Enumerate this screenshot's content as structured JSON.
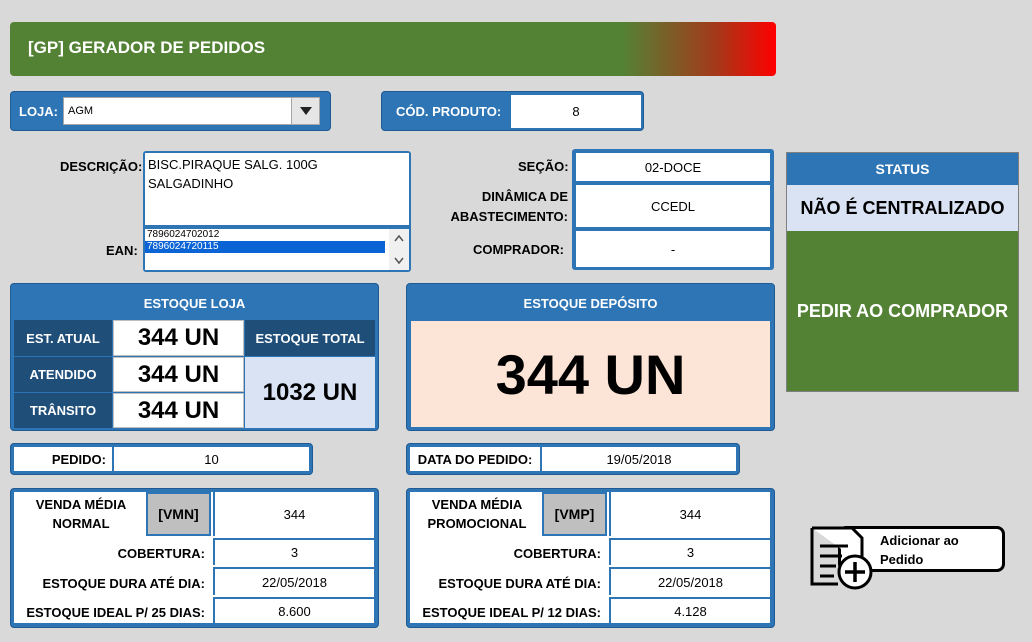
{
  "header": {
    "title": "[GP] GERADOR DE PEDIDOS"
  },
  "loja": {
    "label": "LOJA:",
    "value": "AGM"
  },
  "produto": {
    "label": "CÓD. PRODUTO:",
    "value": "8"
  },
  "descricao": {
    "label": "DESCRIÇÃO:",
    "line1": "BISC.PIRAQUE SALG. 100G",
    "line2": "SALGADINHO"
  },
  "ean": {
    "label": "EAN:",
    "items": [
      "7896024702012",
      "7896024720115"
    ],
    "selected_index": 1
  },
  "secao": {
    "label": "SEÇÃO:",
    "value": "02-DOCE"
  },
  "dinamica": {
    "label_line1": "DINÂMICA DE",
    "label_line2": "ABASTECIMENTO:",
    "value": "CCEDL"
  },
  "comprador": {
    "label": "COMPRADOR:",
    "value": "-"
  },
  "status": {
    "header": "STATUS",
    "value": "NÃO É CENTRALIZADO",
    "action": "PEDIR AO COMPRADOR"
  },
  "estoque_loja": {
    "header": "ESTOQUE LOJA",
    "rows": [
      {
        "label": "EST. ATUAL",
        "value": "344 UN"
      },
      {
        "label": "ATENDIDO",
        "value": "344 UN"
      },
      {
        "label": "TRÂNSITO",
        "value": "344 UN"
      }
    ],
    "total_label": "ESTOQUE TOTAL",
    "total_value": "1032 UN"
  },
  "estoque_deposito": {
    "header": "ESTOQUE DEPÓSITO",
    "value": "344 UN"
  },
  "pedido": {
    "label": "PEDIDO:",
    "value": "10"
  },
  "data_pedido": {
    "label": "DATA DO PEDIDO:",
    "value": "19/05/2018"
  },
  "venda_normal": {
    "label_line1": "VENDA MÉDIA",
    "label_line2": "NORMAL",
    "code": "[VMN]",
    "value": "344",
    "cobertura_label": "COBERTURA:",
    "cobertura": "3",
    "dura_label": "ESTOQUE DURA ATÉ DIA:",
    "dura": "22/05/2018",
    "ideal_label": "ESTOQUE IDEAL P/ 25 DIAS:",
    "ideal": "8.600"
  },
  "venda_promo": {
    "label_line1": "VENDA MÉDIA",
    "label_line2": "PROMOCIONAL",
    "code": "[VMP]",
    "value": "344",
    "cobertura_label": "COBERTURA:",
    "cobertura": "3",
    "dura_label": "ESTOQUE DURA ATÉ DIA:",
    "dura": "22/05/2018",
    "ideal_label": "ESTOQUE IDEAL P/ 12 DIAS:",
    "ideal": "4.128"
  },
  "add_button": {
    "line1": "Adicionar ao",
    "line2": "Pedido",
    "icon": "add-document-icon"
  },
  "colors": {
    "blue": "#2e75b6",
    "dark_blue": "#1f4e79",
    "green": "#548235",
    "red": "#ff0000",
    "peach": "#fce4d6",
    "light_blue": "#dae3f3"
  }
}
